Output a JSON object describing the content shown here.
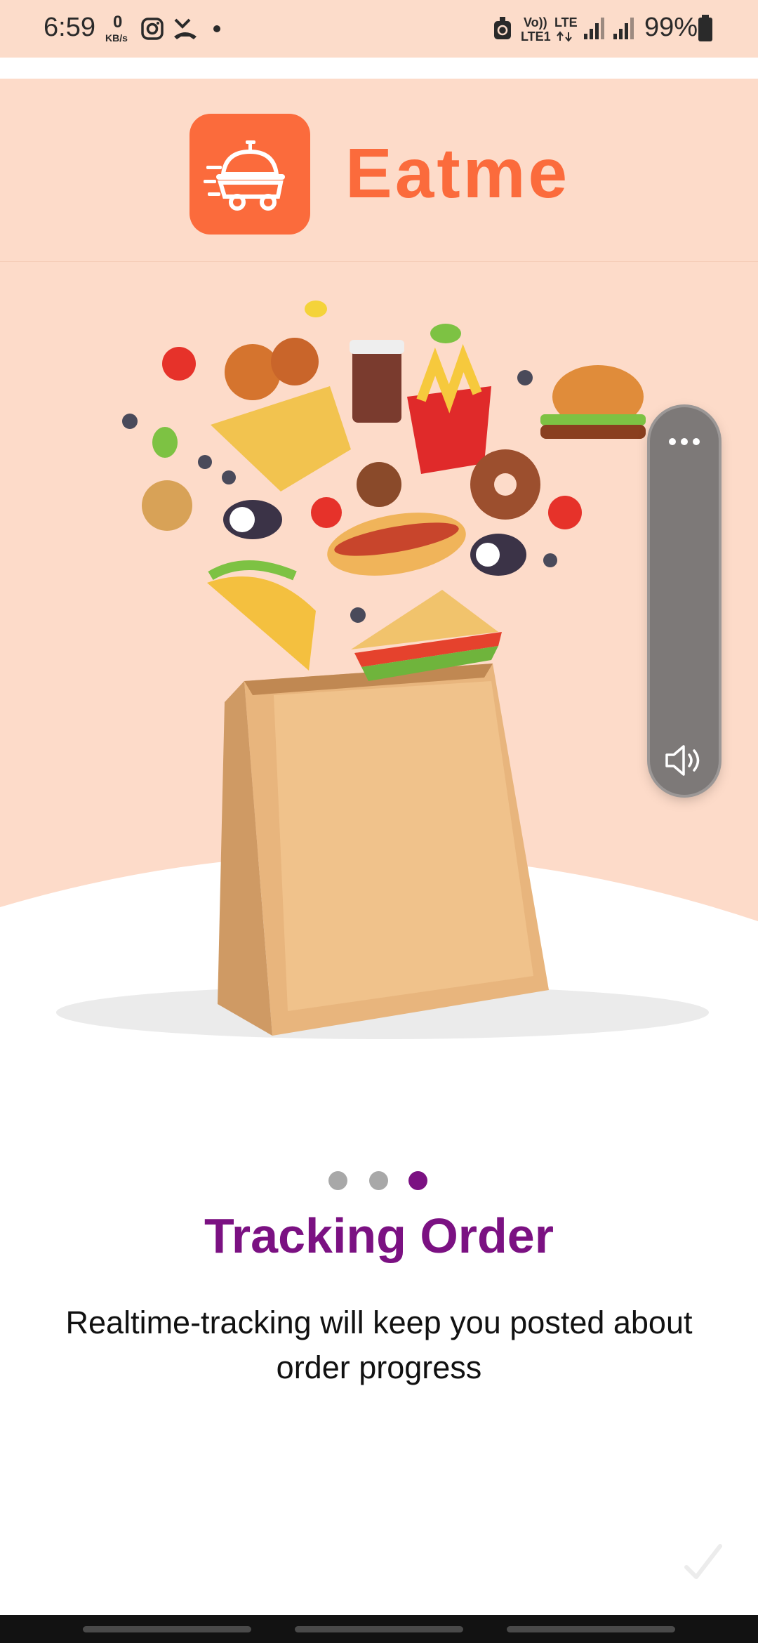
{
  "status_bar": {
    "time": "6:59",
    "net_speed_value": "0",
    "net_speed_unit": "KB/s",
    "volte_label": "Vo))",
    "lte1_label": "LTE1",
    "lte_label": "LTE",
    "battery": "99%"
  },
  "brand": {
    "name": "Eatme",
    "accent_color": "#fb6b3c"
  },
  "onboarding": {
    "page_indicator": {
      "total": 3,
      "active_index": 2
    },
    "title": "Tracking Order",
    "description": "Realtime-tracking will keep you posted about order progress",
    "title_color": "#7b1182",
    "active_dot_color": "#7b1182",
    "inactive_dot_color": "#a8a8a8"
  },
  "side_panel": {
    "menu_icon": "more-horizontal-icon",
    "volume_icon": "speaker-icon"
  },
  "done_icon": "checkmark-icon"
}
